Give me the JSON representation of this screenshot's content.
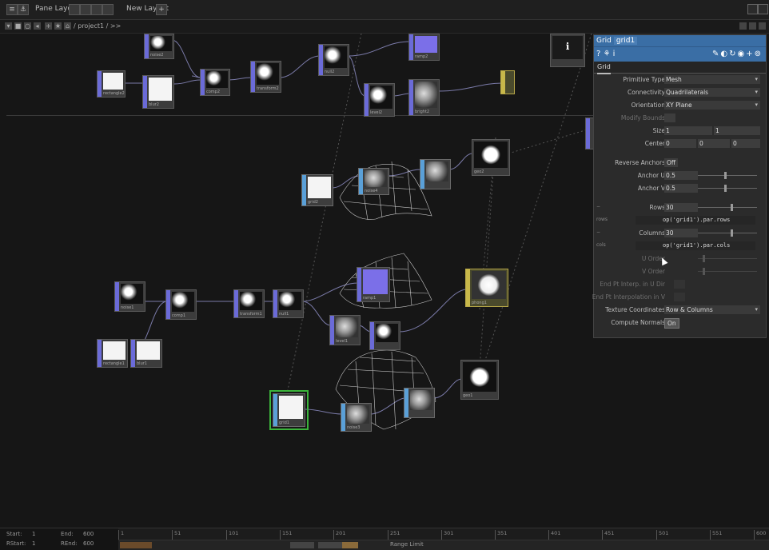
{
  "toolbar": {
    "pane_layout": "Pane Layout",
    "new_layout": "New Layout",
    "path": "/ project1 / >>"
  },
  "nodes": [
    {
      "name": "noise2",
      "thumb": "noise",
      "kind": "top"
    },
    {
      "name": "rectangle2",
      "thumb": "white",
      "kind": "top"
    },
    {
      "name": "blur2",
      "thumb": "white",
      "kind": "top"
    },
    {
      "name": "comp2",
      "thumb": "noise",
      "kind": "top"
    },
    {
      "name": "transform2",
      "thumb": "noise",
      "kind": "top"
    },
    {
      "name": "null2",
      "thumb": "noise",
      "kind": "top"
    },
    {
      "name": "ramp2",
      "thumb": "purple",
      "kind": "top"
    },
    {
      "name": "level2",
      "thumb": "noise",
      "kind": "top"
    },
    {
      "name": "bright2",
      "thumb": "gray",
      "kind": "top"
    },
    {
      "name": "grid2",
      "thumb": "white",
      "kind": "sop"
    },
    {
      "name": "noise4",
      "thumb": "gray",
      "kind": "sop"
    },
    {
      "name": "geo2",
      "thumb": "white",
      "kind": "sop"
    },
    {
      "name": "noise1",
      "thumb": "noise",
      "kind": "top"
    },
    {
      "name": "comp1",
      "thumb": "noise",
      "kind": "top"
    },
    {
      "name": "transform1",
      "thumb": "noise",
      "kind": "top"
    },
    {
      "name": "null1",
      "thumb": "noise",
      "kind": "top"
    },
    {
      "name": "ramp1",
      "thumb": "purple",
      "kind": "top"
    },
    {
      "name": "level1",
      "thumb": "gray",
      "kind": "top"
    },
    {
      "name": "rectangle1",
      "thumb": "white",
      "kind": "top"
    },
    {
      "name": "blur1",
      "thumb": "white",
      "kind": "top"
    },
    {
      "name": "phong1",
      "thumb": "white",
      "kind": "mat"
    },
    {
      "name": "grid1",
      "thumb": "white",
      "kind": "sop"
    },
    {
      "name": "noise3",
      "thumb": "gray",
      "kind": "sop"
    },
    {
      "name": "geo1",
      "thumb": "white",
      "kind": "sop"
    },
    {
      "name": "null3",
      "thumb": "white",
      "kind": "sop"
    }
  ],
  "panel": {
    "op_type": "Grid",
    "op_name": "grid1",
    "tab": "Grid",
    "params": {
      "primitive_type": {
        "label": "Primitive Type",
        "value": "Mesh"
      },
      "connectivity": {
        "label": "Connectivity",
        "value": "Quadrilaterals"
      },
      "orientation": {
        "label": "Orientation",
        "value": "XY Plane"
      },
      "modify_bounds": {
        "label": "Modify Bounds"
      },
      "size": {
        "label": "Size",
        "x": "1",
        "y": "1"
      },
      "center": {
        "label": "Center",
        "x": "0",
        "y": "0",
        "z": "0"
      },
      "reverse_anchors": {
        "label": "Reverse Anchors",
        "value": "Off"
      },
      "anchor_u": {
        "label": "Anchor U",
        "value": "0.5"
      },
      "anchor_v": {
        "label": "Anchor V",
        "value": "0.5"
      },
      "rows": {
        "label": "Rows",
        "value": "30",
        "side": "rows",
        "expr": "op('grid1').par.rows"
      },
      "columns": {
        "label": "Columns",
        "value": "30",
        "side": "cols",
        "expr": "op('grid1').par.cols"
      },
      "u_order": {
        "label": "U Order"
      },
      "v_order": {
        "label": "V Order"
      },
      "end_u": {
        "label": "End Pt Interp. in U Dir"
      },
      "end_v": {
        "label": "End Pt Interpolation in V"
      },
      "texture_coords": {
        "label": "Texture Coordinates",
        "value": "Row & Columns"
      },
      "compute_normals": {
        "label": "Compute Normals",
        "value": "On"
      }
    }
  },
  "timeline": {
    "start_label": "Start:",
    "start": "1",
    "end_label": "End:",
    "end": "600",
    "rstart_label": "RStart:",
    "rstart": "1",
    "rend_label": "REnd:",
    "rend": "600",
    "ticks": [
      "1",
      "51",
      "101",
      "151",
      "201",
      "251",
      "301",
      "351",
      "401",
      "451",
      "501",
      "551",
      "600"
    ],
    "range_limit": "Range Limit"
  }
}
